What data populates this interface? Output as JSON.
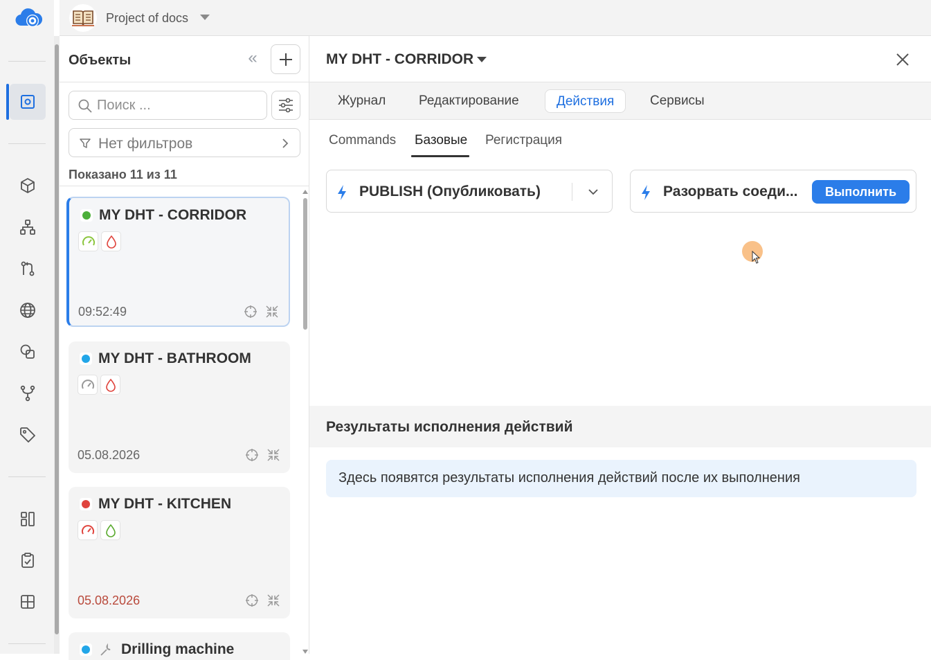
{
  "app": {
    "project_name": "Project of docs"
  },
  "rail": {
    "items": [
      {
        "name": "objects",
        "icon": "device-square-icon",
        "active": true
      },
      {
        "name": "models",
        "icon": "cube-icon"
      },
      {
        "name": "hierarchy",
        "icon": "hierarchy-icon"
      },
      {
        "name": "transforms",
        "icon": "flow-icon"
      },
      {
        "name": "globe",
        "icon": "globe-icon"
      },
      {
        "name": "shapes",
        "icon": "shapes-icon"
      },
      {
        "name": "branches",
        "icon": "branch-icon"
      },
      {
        "name": "tags",
        "icon": "tag-icon"
      },
      {
        "name": "dashboards",
        "icon": "dashboard-icon"
      },
      {
        "name": "tasks",
        "icon": "clipboard-check-icon"
      },
      {
        "name": "apps",
        "icon": "grid-icon"
      }
    ]
  },
  "objects_panel": {
    "title": "Объекты",
    "search_placeholder": "Поиск ...",
    "filters_label": "Нет фильтров",
    "shown_count": "Показано 11 из 11",
    "cards": [
      {
        "name": "MY DHT - CORRIDOR",
        "status_color": "#4caf3a",
        "time": "09:52:49",
        "time_alert": false,
        "badges": [
          "gauge-green-icon",
          "drop-red-icon"
        ],
        "selected": true
      },
      {
        "name": "MY DHT - BATHROOM",
        "status_color": "#22a6e8",
        "time": "05.08.2026",
        "time_alert": false,
        "badges": [
          "gauge-gray-icon",
          "drop-red-icon"
        ],
        "selected": false
      },
      {
        "name": "MY DHT - KITCHEN",
        "status_color": "#e0443d",
        "time": "05.08.2026",
        "time_alert": true,
        "badges": [
          "gauge-red-icon",
          "drop-green-icon"
        ],
        "selected": false
      },
      {
        "name": "Drilling machine",
        "status_color": "#22a6e8",
        "time": "",
        "time_alert": false,
        "badges": [],
        "selected": false
      }
    ]
  },
  "detail": {
    "title": "MY DHT - CORRIDOR",
    "tabs": [
      "Журнал",
      "Редактирование",
      "Действия",
      "Сервисы"
    ],
    "active_tab": "Действия",
    "subtabs": [
      "Commands",
      "Базовые",
      "Регистрация"
    ],
    "active_subtab": "Базовые",
    "action_select": "PUBLISH (Опубликовать)",
    "action_quick": "Разорвать соеди...",
    "run_label": "Выполнить",
    "results_title": "Результаты исполнения действий",
    "results_note": "Здесь появятся результаты исполнения действий после их выполнения"
  },
  "colors": {
    "accent": "#2b7de9",
    "rail_bg": "#f3f3f3"
  }
}
